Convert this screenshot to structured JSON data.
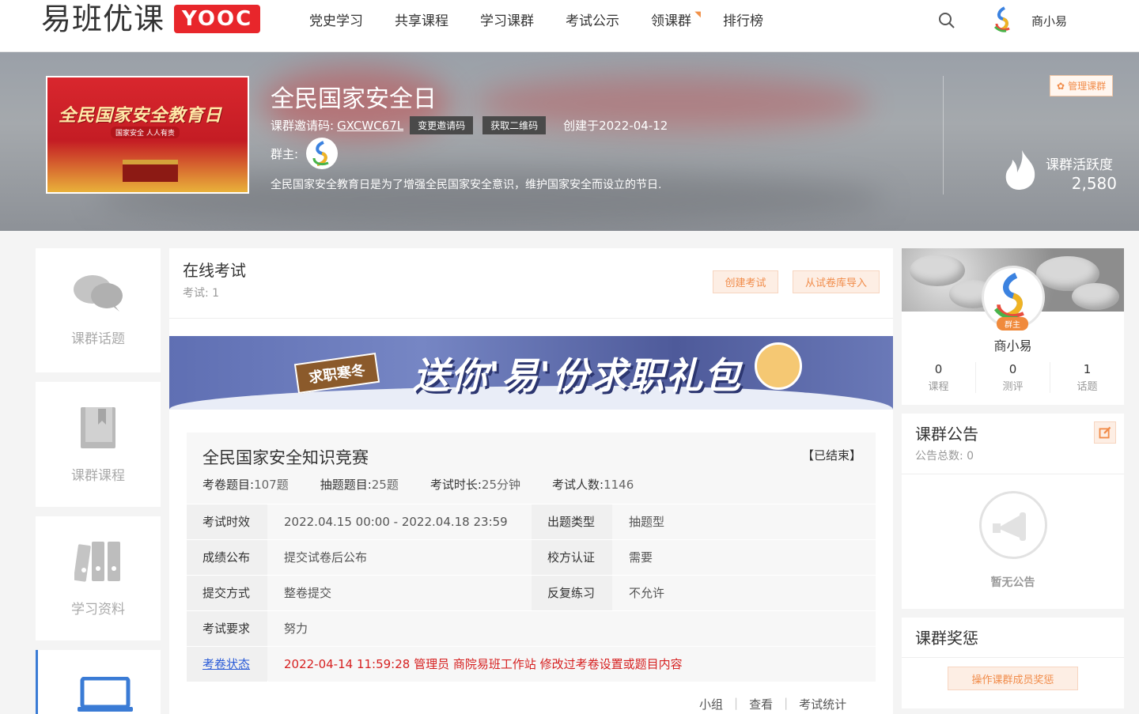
{
  "header": {
    "logo_text": "易班优课",
    "logo_badge": "YOOC",
    "nav": [
      "党史学习",
      "共享课程",
      "学习课群",
      "考试公示",
      "领课群",
      "排行榜"
    ],
    "user_name": "商小易"
  },
  "banner": {
    "cover_title": "全民国家安全教育日",
    "cover_subtitle": "国家安全 人人有责",
    "title": "全民国家安全日",
    "invite_label": "课群邀请码:",
    "invite_code": "GXCWC67L",
    "change_code_btn": "变更邀请码",
    "qr_btn": "获取二维码",
    "created": "创建于2022-04-12",
    "owner_label": "群主:",
    "description": "全民国家安全教育日是为了增强全民国家安全意识，维护国家安全而设立的节日.",
    "manage_btn": "管理课群",
    "activity_label": "课群活跃度",
    "activity_value": "2,580"
  },
  "sidebar": {
    "items": [
      {
        "label": "课群话题"
      },
      {
        "label": "课群课程"
      },
      {
        "label": "学习资料"
      }
    ]
  },
  "exam_section": {
    "title": "在线考试",
    "count_label": "考试: 1",
    "create_btn": "创建考试",
    "import_btn": "从试卷库导入"
  },
  "promo": {
    "sign": "求职寒冬",
    "text": "送你'易'份求职礼包"
  },
  "exam": {
    "title": "全民国家安全知识竞赛",
    "status": "【已结束】",
    "meta": [
      {
        "label": "考卷题目:",
        "value": "107题"
      },
      {
        "label": "抽题题目:",
        "value": "25题"
      },
      {
        "label": "考试时长:",
        "value": "25分钟"
      },
      {
        "label": "考试人数:",
        "value": "1146"
      }
    ],
    "rows": [
      {
        "l1": "考试时效",
        "v1": "2022.04.15 00:00 - 2022.04.18 23:59",
        "l2": "出题类型",
        "v2": "抽题型"
      },
      {
        "l1": "成绩公布",
        "v1": "提交试卷后公布",
        "l2": "校方认证",
        "v2": "需要"
      },
      {
        "l1": "提交方式",
        "v1": "整卷提交",
        "l2": "反复练习",
        "v2": "不允许"
      }
    ],
    "requirement_label": "考试要求",
    "requirement_value": "努力",
    "status_label": "考卷状态",
    "status_value": "2022-04-14 11:59:28 管理员 商院易班工作站 修改过考卷设置或题目内容",
    "footer": [
      "小组",
      "查看",
      "考试统计"
    ]
  },
  "profile": {
    "badge": "群主",
    "name": "商小易",
    "stats": [
      {
        "n": "0",
        "l": "课程"
      },
      {
        "n": "0",
        "l": "测评"
      },
      {
        "n": "1",
        "l": "话题"
      }
    ]
  },
  "notice": {
    "title": "课群公告",
    "count": "公告总数: 0",
    "empty": "暂无公告"
  },
  "reward": {
    "title": "课群奖惩",
    "btn": "操作课群成员奖惩"
  },
  "colors": {
    "accent_orange": "#f18c4a",
    "brand_red": "#e8262b",
    "link_blue": "#2a5bd7",
    "alert_red": "#d62020"
  }
}
